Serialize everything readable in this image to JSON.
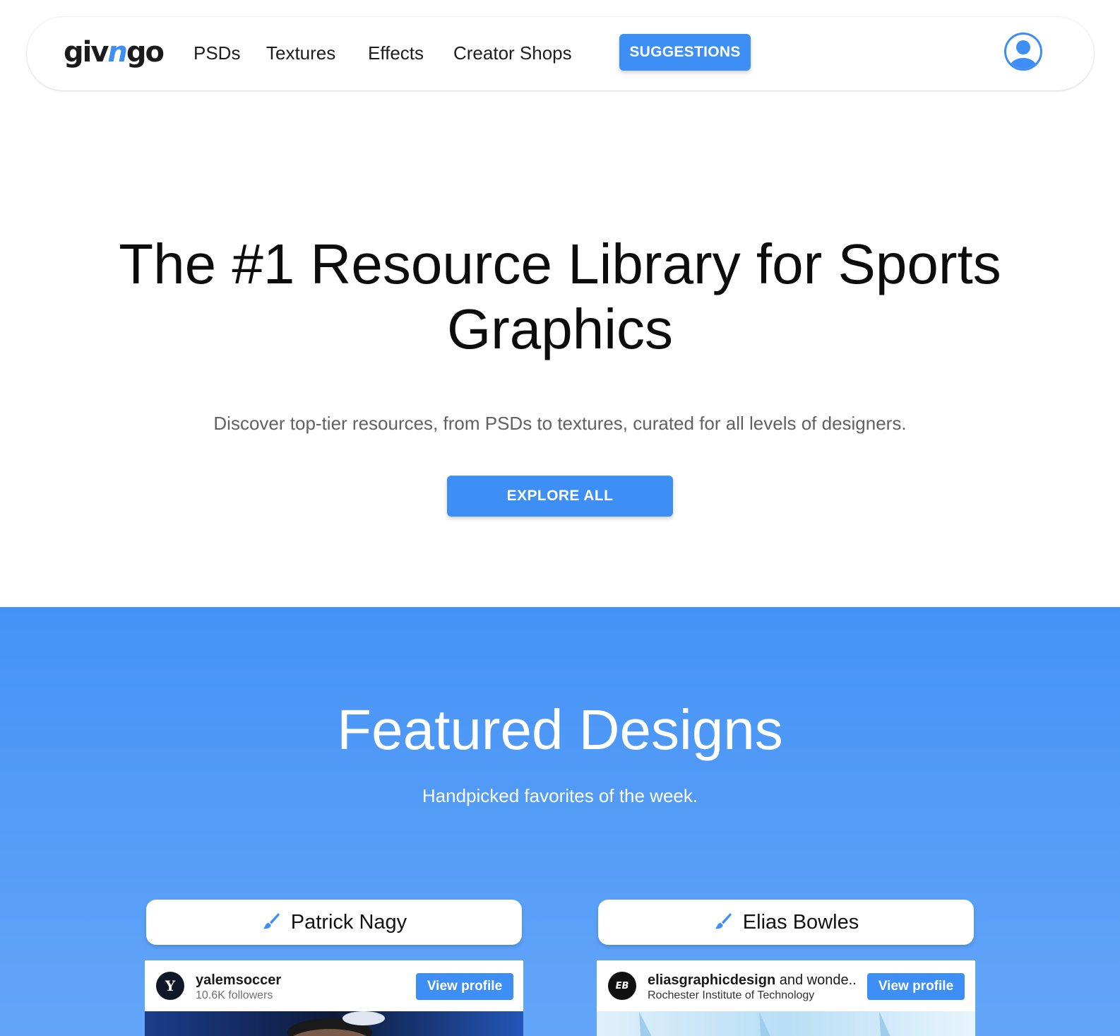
{
  "nav": {
    "logo": {
      "prefix": "giv",
      "accent": "n",
      "suffix": "go"
    },
    "links": [
      "PSDs",
      "Textures",
      "Effects",
      "Creator Shops"
    ],
    "suggestions_label": "SUGGESTIONS",
    "account_icon": "account-circle-icon"
  },
  "hero": {
    "title": "The #1 Resource Library for Sports Graphics",
    "subtitle": "Discover top-tier resources, from PSDs to textures, curated for all levels of designers.",
    "cta_label": "EXPLORE ALL"
  },
  "featured": {
    "title": "Featured Designs",
    "subtitle": "Handpicked favorites of the week.",
    "cards": [
      {
        "designer": "Patrick Nagy",
        "designer_icon": "paintbrush-icon",
        "account_handle": "yalemsoccer",
        "account_extra": "",
        "account_meta": "10.6K followers",
        "avatar_letter": "Y",
        "view_label": "View profile"
      },
      {
        "designer": "Elias Bowles",
        "designer_icon": "paintbrush-icon",
        "account_handle": "eliasgraphicdesign",
        "account_extra": "and wonde..",
        "account_meta": "Rochester Institute of Technology",
        "avatar_letter": "EB",
        "view_label": "View profile"
      }
    ]
  },
  "colors": {
    "accent": "#3d8ef5",
    "featured_bg_top": "#4592f6",
    "featured_bg_bottom": "#63a6f9"
  }
}
